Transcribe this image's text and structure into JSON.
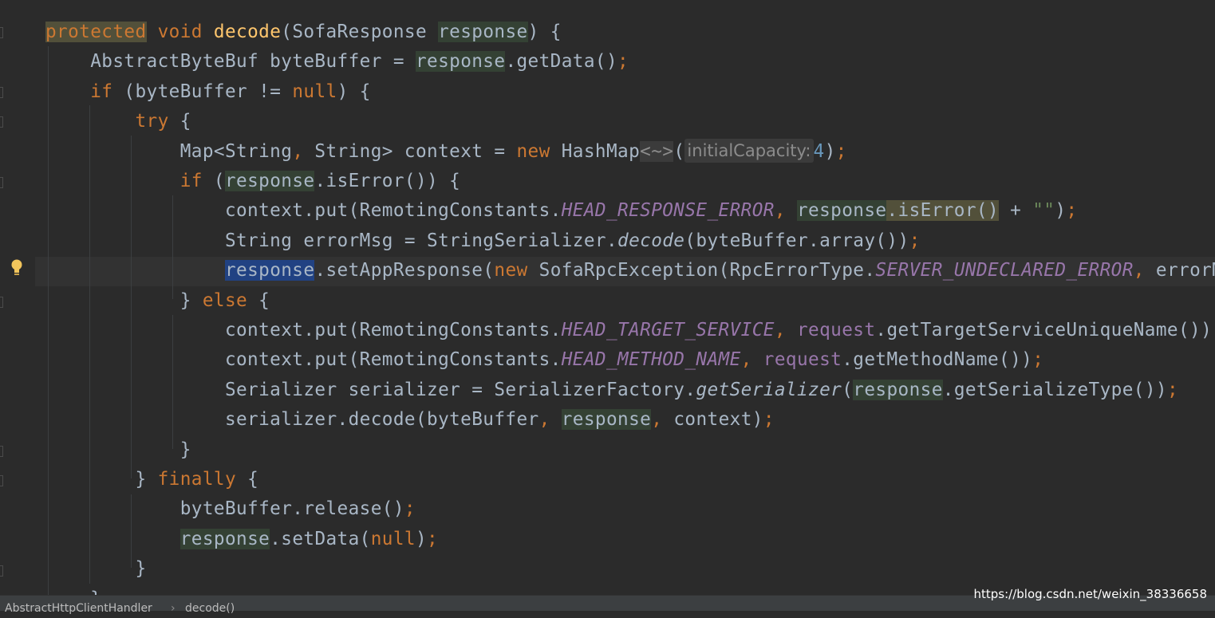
{
  "editor": {
    "lines": [
      [
        {
          "t": "protected",
          "c": "kw hl-y"
        },
        {
          "t": " "
        },
        {
          "t": "void",
          "c": "kw"
        },
        {
          "t": " "
        },
        {
          "t": "decode",
          "c": "fn"
        },
        {
          "t": "(SofaResponse "
        },
        {
          "t": "response",
          "c": "hl-g"
        },
        {
          "t": ") {"
        }
      ],
      [
        {
          "t": "    AbstractByteBuf byteBuffer = "
        },
        {
          "t": "response",
          "c": "hl-g"
        },
        {
          "t": ".getData()"
        },
        {
          "t": ";",
          "c": "semi"
        }
      ],
      [
        {
          "t": "    "
        },
        {
          "t": "if",
          "c": "kw"
        },
        {
          "t": " (byteBuffer != "
        },
        {
          "t": "null",
          "c": "kw"
        },
        {
          "t": ") {"
        }
      ],
      [
        {
          "t": "        "
        },
        {
          "t": "try",
          "c": "kw"
        },
        {
          "t": " {"
        }
      ],
      [
        {
          "t": "            Map<String"
        },
        {
          "t": ",",
          "c": "semi"
        },
        {
          "t": " String> context = "
        },
        {
          "t": "new",
          "c": "kw"
        },
        {
          "t": " HashMap"
        },
        {
          "t": "<~>",
          "c": "diamond"
        },
        {
          "t": "("
        },
        {
          "hint": "initialCapacity:"
        },
        {
          "t": "4",
          "c": "num"
        },
        {
          "t": ")"
        },
        {
          "t": ";",
          "c": "semi"
        }
      ],
      [
        {
          "t": "            "
        },
        {
          "t": "if",
          "c": "kw"
        },
        {
          "t": " ("
        },
        {
          "t": "response",
          "c": "hl-g"
        },
        {
          "t": ".isError()) {"
        }
      ],
      [
        {
          "t": "                context.put(RemotingConstants."
        },
        {
          "t": "HEAD_RESPONSE_ERROR",
          "c": "const"
        },
        {
          "t": ",",
          "c": "semi"
        },
        {
          "t": " "
        },
        {
          "t": "response",
          "c": "hl-g"
        },
        {
          "t": ".isError()",
          "c": "hl-y"
        },
        {
          "t": " + "
        },
        {
          "t": "\"\"",
          "c": "str"
        },
        {
          "t": ")"
        },
        {
          "t": ";",
          "c": "semi"
        }
      ],
      [
        {
          "t": "                String errorMsg = StringSerializer."
        },
        {
          "t": "decode",
          "c": "it"
        },
        {
          "t": "(byteBuffer.array())"
        },
        {
          "t": ";",
          "c": "semi"
        }
      ],
      [
        {
          "t": "                "
        },
        {
          "t": "response",
          "c": "hl-b"
        },
        {
          "t": ".setAppResponse("
        },
        {
          "t": "new",
          "c": "kw"
        },
        {
          "t": " SofaRpcException(RpcErrorType."
        },
        {
          "t": "SERVER_UNDECLARED_ERROR",
          "c": "const"
        },
        {
          "t": ",",
          "c": "semi"
        },
        {
          "t": " errorMsg))"
        },
        {
          "t": ";",
          "c": "semi"
        }
      ],
      [
        {
          "t": "            } "
        },
        {
          "t": "else",
          "c": "kw"
        },
        {
          "t": " {"
        }
      ],
      [
        {
          "t": "                context.put(RemotingConstants."
        },
        {
          "t": "HEAD_TARGET_SERVICE",
          "c": "const"
        },
        {
          "t": ",",
          "c": "semi"
        },
        {
          "t": " "
        },
        {
          "t": "request",
          "c": "field"
        },
        {
          "t": ".getTargetServiceUniqueName())"
        },
        {
          "t": ";",
          "c": "semi"
        }
      ],
      [
        {
          "t": "                context.put(RemotingConstants."
        },
        {
          "t": "HEAD_METHOD_NAME",
          "c": "const"
        },
        {
          "t": ",",
          "c": "semi"
        },
        {
          "t": " "
        },
        {
          "t": "request",
          "c": "field"
        },
        {
          "t": ".getMethodName())"
        },
        {
          "t": ";",
          "c": "semi"
        }
      ],
      [
        {
          "t": "                Serializer serializer = SerializerFactory."
        },
        {
          "t": "getSerializer",
          "c": "it"
        },
        {
          "t": "("
        },
        {
          "t": "response",
          "c": "hl-g"
        },
        {
          "t": ".getSerializeType())"
        },
        {
          "t": ";",
          "c": "semi"
        }
      ],
      [
        {
          "t": "                serializer.decode(byteBuffer"
        },
        {
          "t": ",",
          "c": "semi"
        },
        {
          "t": " "
        },
        {
          "t": "response",
          "c": "hl-g"
        },
        {
          "t": ",",
          "c": "semi"
        },
        {
          "t": " context)"
        },
        {
          "t": ";",
          "c": "semi"
        }
      ],
      [
        {
          "t": "            }"
        }
      ],
      [
        {
          "t": "        } "
        },
        {
          "t": "finally",
          "c": "kw"
        },
        {
          "t": " {"
        }
      ],
      [
        {
          "t": "            byteBuffer.release()"
        },
        {
          "t": ";",
          "c": "semi"
        }
      ],
      [
        {
          "t": "            "
        },
        {
          "t": "response",
          "c": "hl-g"
        },
        {
          "t": ".setData("
        },
        {
          "t": "null",
          "c": "kw"
        },
        {
          "t": ")"
        },
        {
          "t": ";",
          "c": "semi"
        }
      ],
      [
        {
          "t": "        }"
        }
      ],
      [
        {
          "t": "    }"
        }
      ]
    ]
  },
  "statusbar": {
    "breadcrumb_class": "AbstractHttpClientHandler",
    "breadcrumb_separator": "›",
    "breadcrumb_method": "decode()"
  },
  "watermark": "https://blog.csdn.net/weixin_38336658",
  "colors": {
    "background": "#2b2b2b",
    "keyword": "#cc7832",
    "method": "#ffc66d",
    "constant": "#9876aa",
    "default_text": "#a9b7c6",
    "number": "#6897bb",
    "string": "#6a8759",
    "read_highlight": "#344134",
    "write_highlight": "#52503a",
    "selection": "#214283"
  },
  "icons": {
    "gutter_intention": "lightbulb-icon"
  }
}
